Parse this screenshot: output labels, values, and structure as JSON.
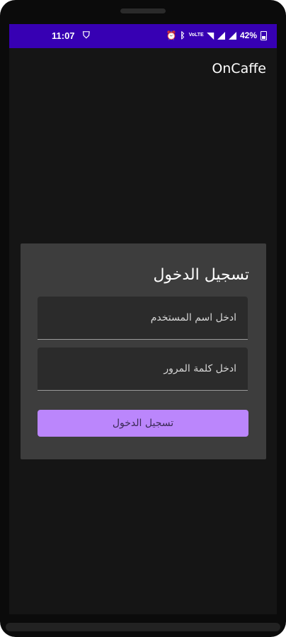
{
  "status_bar": {
    "time": "11:07",
    "app_icon": "shield-icon",
    "alarm_icon": "alarm-icon",
    "bluetooth_icon": "bluetooth-icon",
    "network_label": "VoLTE",
    "wifi_icon": "wifi-icon",
    "battery_percent": "42%",
    "background": "#3700b3"
  },
  "app_bar": {
    "title": "OnCaffe"
  },
  "login_card": {
    "title": "تسجيل الدخول",
    "username_placeholder": "ادخل اسم المستخدم",
    "username_value": "",
    "password_placeholder": "ادخل كلمة المرور",
    "password_value": "",
    "submit_label": "تسجيل الدخول",
    "accent_color": "#bb86fc"
  }
}
